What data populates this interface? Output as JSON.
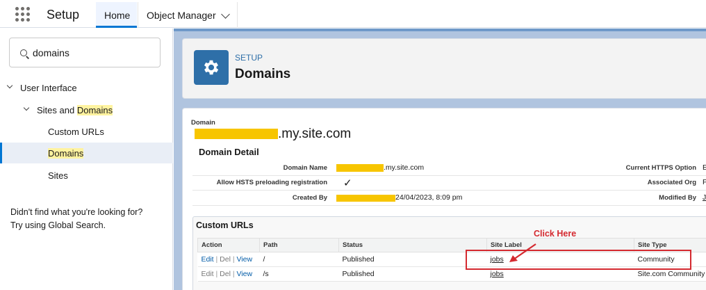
{
  "app": {
    "name": "Setup"
  },
  "tabs": [
    {
      "label": "Home"
    },
    {
      "label": "Object Manager"
    }
  ],
  "search": {
    "value": "domains"
  },
  "tree": {
    "parent": "User Interface",
    "child_prefix": "Sites and ",
    "child_match": "Domains",
    "items": [
      "Custom URLs",
      "Domains",
      "Sites"
    ]
  },
  "help": {
    "line1": "Didn't find what you're looking for?",
    "line2": "Try using Global Search."
  },
  "header": {
    "eyebrow": "SETUP",
    "title": "Domains"
  },
  "domain": {
    "label": "Domain",
    "name_suffix": ".my.site.com",
    "detail_title": "Domain Detail",
    "fields": {
      "domain_name_label": "Domain Name",
      "domain_name_value": ".my.site.com",
      "hsts_label": "Allow HSTS preloading registration",
      "hsts_value": "✓",
      "created_by_label": "Created By",
      "created_by_value": " 24/04/2023, 8:09 pm",
      "https_label": "Current HTTPS Option",
      "https_value": "E",
      "org_label": "Associated Org",
      "org_value": "P",
      "modified_label": "Modified By",
      "modified_value": "Ji"
    }
  },
  "custom_urls": {
    "title": "Custom URLs",
    "columns": [
      "Action",
      "Path",
      "Status",
      "Site Label",
      "Site Type"
    ],
    "actions": {
      "edit": "Edit",
      "del": "Del",
      "view": "View",
      "sep": " | "
    },
    "rows": [
      {
        "path": "/",
        "status": "Published",
        "site_label": "jobs",
        "site_type": "Community"
      },
      {
        "path": "/s",
        "status": "Published",
        "site_label": "jobs",
        "site_type": "Site.com Community"
      }
    ]
  },
  "annotation": {
    "text": "Click Here",
    "color": "#d4292f"
  },
  "colors": {
    "accent": "#0176d3",
    "setup_icon": "#2e6fa8",
    "redaction": "#f7c500",
    "highlight": "#fff3a0"
  }
}
